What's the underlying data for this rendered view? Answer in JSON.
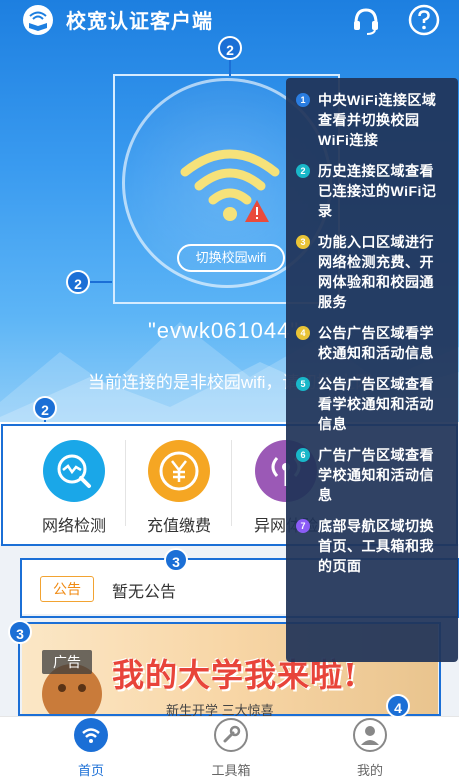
{
  "app": {
    "title": "校宽认证客户端"
  },
  "colors": {
    "primary": "#1b6fd6",
    "accent_orange": "#f08a12",
    "network_icon": "#1aa7e8",
    "recharge_icon": "#f5a623",
    "other_icon": "#9b59b6"
  },
  "header": {
    "logo_icon": "book-wifi-icon",
    "support_icon": "headset-icon",
    "help_icon": "question-icon"
  },
  "wifi": {
    "switch_label": "切换校园wifi",
    "ssid": "\"evwk061044\"",
    "notice": "当前连接的是非校园wifi，请切换 上网"
  },
  "badges": {
    "b1": "2",
    "b2": "2",
    "b3": "2",
    "b4": "3",
    "b5": "3",
    "b6": "4"
  },
  "entries": [
    {
      "label": "网络检测",
      "icon": "network-check-icon"
    },
    {
      "label": "充值缴费",
      "icon": "yuan-icon"
    },
    {
      "label": "异网体验",
      "icon": "signal-icon"
    }
  ],
  "announcement": {
    "tag": "公告",
    "text": "暂无公告"
  },
  "ad": {
    "tag": "广告",
    "headline": "我的大学我来啦!",
    "sub": "新生开学 三大惊喜"
  },
  "nav": [
    {
      "label": "首页",
      "icon": "wifi-home-icon",
      "active": true
    },
    {
      "label": "工具箱",
      "icon": "wrench-icon",
      "active": false
    },
    {
      "label": "我的",
      "icon": "user-icon",
      "active": false
    }
  ],
  "tips": [
    {
      "num": "1",
      "color": "#2a7de1",
      "text": "中央WiFi连接区域查看并切换校园WiFi连接"
    },
    {
      "num": "2",
      "color": "#19b7c9",
      "text": "历史连接区域查看已连接过的WiFi记录"
    },
    {
      "num": "3",
      "color": "#e9c437",
      "text": "功能入口区域进行网络检测充费、开网体验和和校园通服务"
    },
    {
      "num": "4",
      "color": "#e9c437",
      "text": "公告广告区域看学校通知和活动信息"
    },
    {
      "num": "5",
      "color": "#19b7c9",
      "text": "公告广告区域查看看学校通知和活动信息"
    },
    {
      "num": "6",
      "color": "#19b7c9",
      "text": "广告广告区域查看学校通知和活动信息"
    },
    {
      "num": "7",
      "color": "#8b5cf6",
      "text": "底部导航区域切换首页、工具箱和我的页面"
    }
  ]
}
